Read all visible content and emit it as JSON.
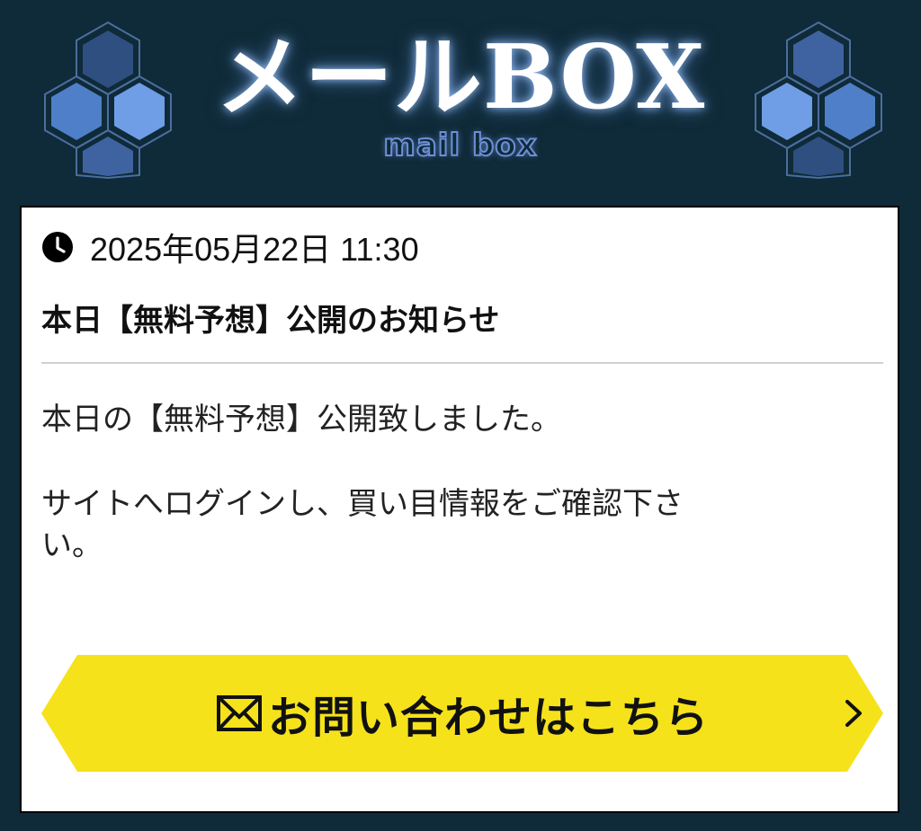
{
  "header": {
    "title": "メールBOX",
    "subtitle": "mail box",
    "left_icon": "hexagon-cluster-icon",
    "right_icon": "hexagon-cluster-icon"
  },
  "message": {
    "clock_icon": "clock-icon",
    "datetime": "2025年05月22日 11:30",
    "subject": "本日【無料予想】公開のお知らせ",
    "body": [
      "本日の【無料予想】公開致しました。",
      "サイトへログインし、買い目情報をご確認下さ",
      "い。"
    ]
  },
  "cta": {
    "mail_icon": "envelope-icon",
    "label": "お問い合わせはこちら",
    "arrow_icon": "chevron-right-icon",
    "color": "#f5e21b"
  },
  "colors": {
    "background": "#0f2a38",
    "accent_blue": "#6e8fd6"
  }
}
